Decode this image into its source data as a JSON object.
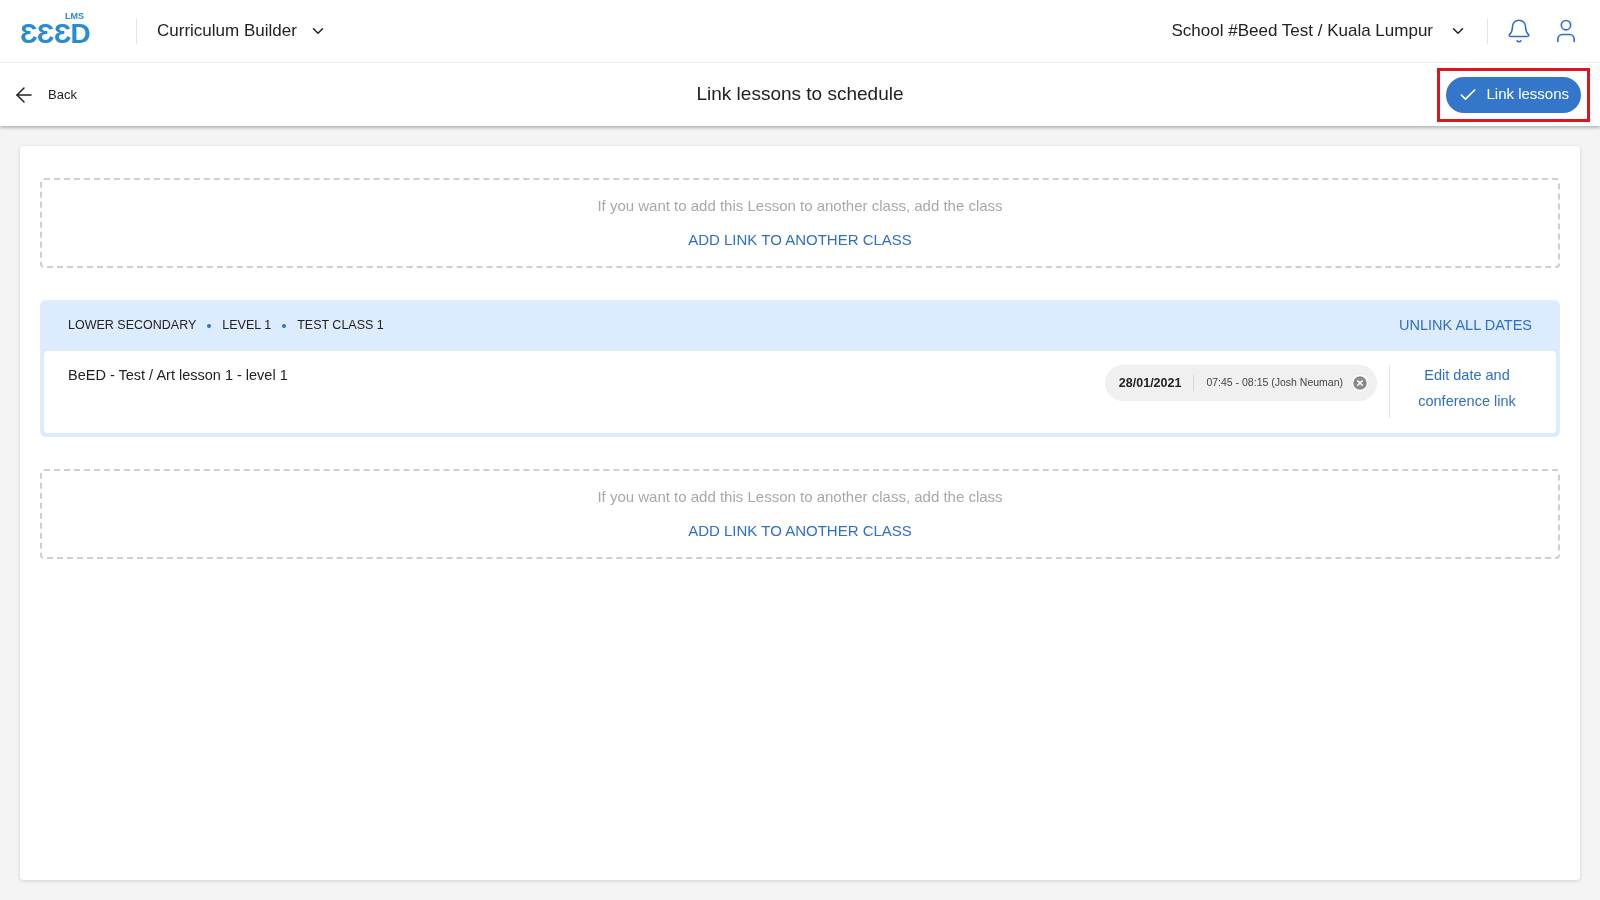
{
  "header": {
    "logo": {
      "text": "ƐƐƐD",
      "tag": "LMS"
    },
    "app_switcher": "Curriculum Builder",
    "school": "School #Beed Test / Kuala Lumpur"
  },
  "toolbar": {
    "back": "Back",
    "title": "Link lessons to schedule",
    "action": {
      "label": "Link lessons",
      "highlighted": true
    }
  },
  "add_link_top": {
    "hint": "If you want to add this Lesson to another class, add the class",
    "action": "ADD LINK TO ANOTHER CLASS"
  },
  "class_group": {
    "breadcrumb": [
      "LOWER SECONDARY",
      "LEVEL 1",
      "TEST CLASS 1"
    ],
    "unlink": "UNLINK ALL DATES",
    "lessons": [
      {
        "title": "BeED - Test / Art lesson 1 - level 1",
        "date": "28/01/2021",
        "time": "07:45 - 08:15 (Josh Neuman)",
        "edit": "Edit date and conference link"
      }
    ]
  },
  "add_link_bottom": {
    "hint": "If you want to add this Lesson to another class, add the class",
    "action": "ADD LINK TO ANOTHER CLASS"
  }
}
